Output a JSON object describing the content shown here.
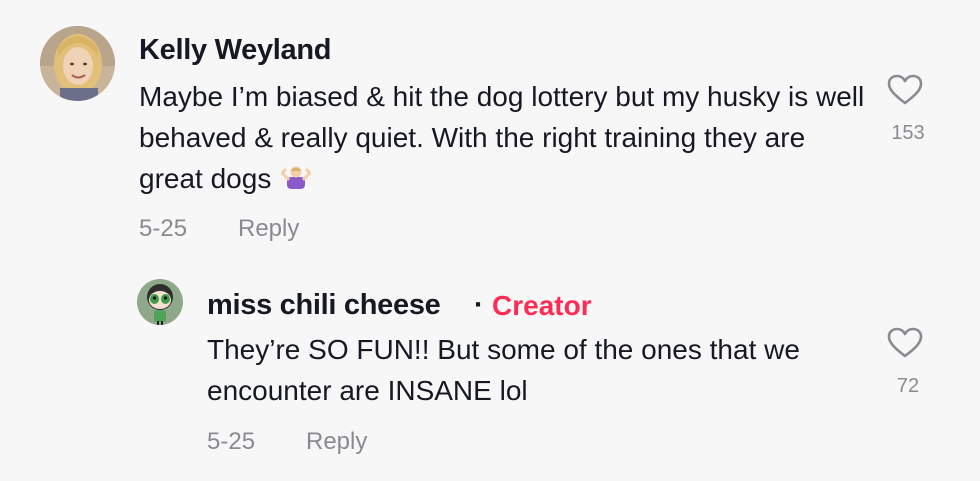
{
  "comments": [
    {
      "username": "Kelly Weyland",
      "text": "Maybe I’m biased & hit the dog lottery but my husky is well behaved & really quiet. With the right training they are great dogs",
      "emoji": "person-shrugging-emoji",
      "date": "5-25",
      "reply_label": "Reply",
      "like_count": "153",
      "like_icon": "heart-outline-icon"
    },
    {
      "username": "miss chili cheese",
      "separator": "·",
      "badge": "Creator",
      "text": "They’re SO FUN!! But some of the ones that we encounter are INSANE lol",
      "date": "5-25",
      "reply_label": "Reply",
      "like_count": "72",
      "like_icon": "heart-outline-icon"
    }
  ],
  "colors": {
    "background": "#f7f7f7",
    "text": "#161823",
    "muted": "#8a8b91",
    "creator_badge": "#fe2c55"
  }
}
